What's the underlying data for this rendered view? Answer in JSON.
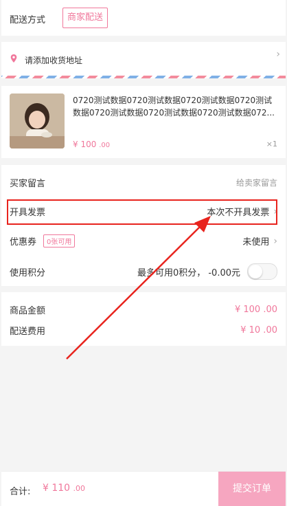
{
  "delivery": {
    "label": "配送方式",
    "option": "商家配送"
  },
  "address": {
    "placeholder_text": "请添加收货地址"
  },
  "product": {
    "title": "0720测试数据0720测试数据0720测试数据0720测试数据0720测试数据0720测试数据0720测试数据072...",
    "price": "¥ 100",
    "price_decimal": ".00",
    "quantity": "×1"
  },
  "options": {
    "buyer_message_label": "买家留言",
    "buyer_message_placeholder": "给卖家留言",
    "invoice_label": "开具发票",
    "invoice_value": "本次不开具发票",
    "coupon_label": "优惠券",
    "coupon_badge": "0张可用",
    "coupon_value": "未使用",
    "points_label": "使用积分",
    "points_info": "最多可用0积分，  -0.00元",
    "points_enabled": false
  },
  "summary": {
    "goods_amount_label": "商品金额",
    "goods_amount_value": "¥ 100 .00",
    "delivery_fee_label": "配送费用",
    "delivery_fee_value": "¥ 10 .00"
  },
  "footer": {
    "total_label": "合计:",
    "total_value": "¥ 110",
    "total_decimal": ".00",
    "submit_label": "提交订单"
  },
  "colors": {
    "accent": "#f0779b",
    "submit_bg": "#f6a6c0",
    "highlight": "#e8231d"
  }
}
